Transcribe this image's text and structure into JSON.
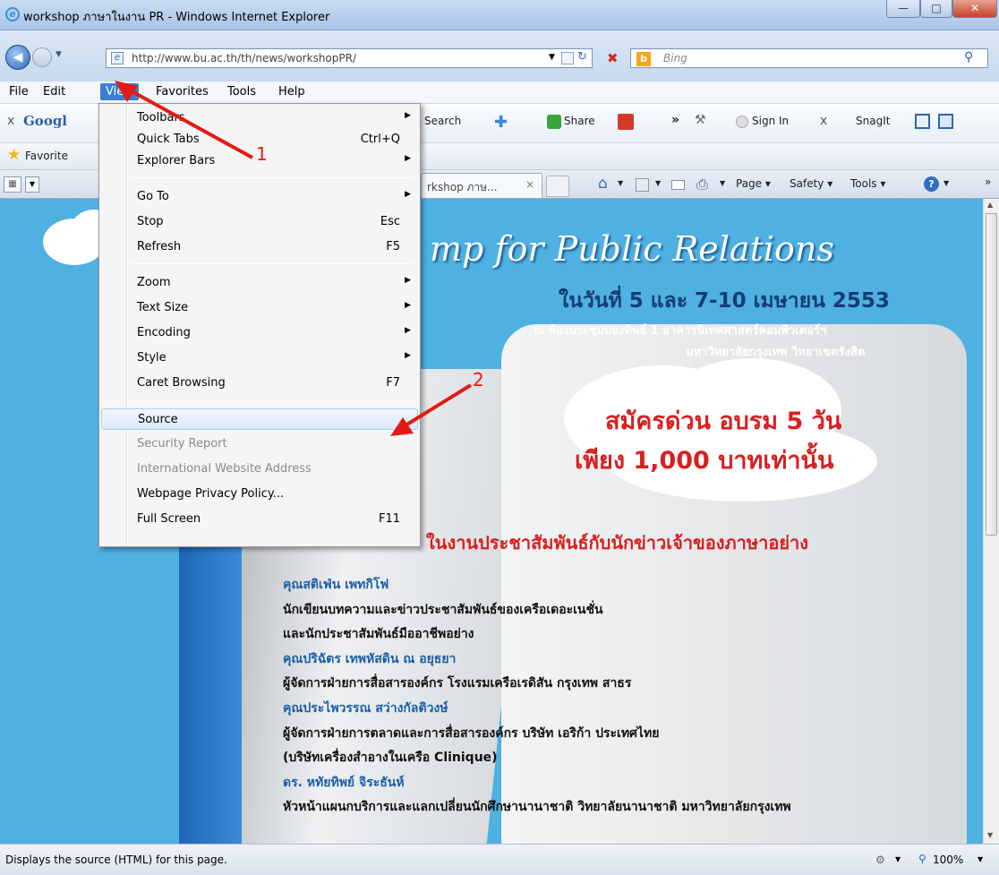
{
  "window": {
    "title": "workshop ภาษาในงาน PR - Windows Internet Explorer"
  },
  "address": {
    "url": "http://www.bu.ac.th/th/news/workshopPR/",
    "search_placeholder": "Bing"
  },
  "menubar": {
    "items": [
      "File",
      "Edit",
      "View",
      "Favorites",
      "Tools",
      "Help"
    ]
  },
  "toolbar": {
    "google": "Googl",
    "search": "Search",
    "share": "Share",
    "sign_in": "Sign In",
    "snagit": "SnagIt",
    "favorites": "Favorite",
    "tab_label": "rkshop ภาษ...",
    "page": "Page",
    "safety": "Safety",
    "tools": "Tools"
  },
  "view_menu": {
    "items": [
      {
        "label": "Toolbars",
        "shortcut": "",
        "submenu": true,
        "disabled": false
      },
      {
        "label": "Quick Tabs",
        "shortcut": "Ctrl+Q",
        "submenu": false,
        "disabled": false
      },
      {
        "label": "Explorer Bars",
        "shortcut": "",
        "submenu": true,
        "disabled": false
      },
      {
        "label": "Go To",
        "shortcut": "",
        "submenu": true,
        "disabled": false
      },
      {
        "label": "Stop",
        "shortcut": "Esc",
        "submenu": false,
        "disabled": false
      },
      {
        "label": "Refresh",
        "shortcut": "F5",
        "submenu": false,
        "disabled": false
      },
      {
        "label": "Zoom",
        "shortcut": "",
        "submenu": true,
        "disabled": false
      },
      {
        "label": "Text Size",
        "shortcut": "",
        "submenu": true,
        "disabled": false
      },
      {
        "label": "Encoding",
        "shortcut": "",
        "submenu": true,
        "disabled": false
      },
      {
        "label": "Style",
        "shortcut": "",
        "submenu": true,
        "disabled": false
      },
      {
        "label": "Caret Browsing",
        "shortcut": "F7",
        "submenu": false,
        "disabled": false
      },
      {
        "label": "Source",
        "shortcut": "",
        "submenu": false,
        "disabled": false,
        "highlighted": true
      },
      {
        "label": "Security Report",
        "shortcut": "",
        "submenu": false,
        "disabled": true
      },
      {
        "label": "International Website Address",
        "shortcut": "",
        "submenu": false,
        "disabled": true
      },
      {
        "label": "Webpage Privacy Policy...",
        "shortcut": "",
        "submenu": false,
        "disabled": false
      },
      {
        "label": "Full Screen",
        "shortcut": "F11",
        "submenu": false,
        "disabled": false
      }
    ]
  },
  "annotations": {
    "one": "1",
    "two": "2"
  },
  "page": {
    "headline": "mp for Public Relations",
    "date": "ในวันที่ 5 และ 7-10 เมษายน 2553",
    "venue1": "ณ ห้องประชุมปองทิพย์ 1 อาคารนิเทศศาสตร์คอมพิวเตอร์ฯ",
    "venue2": "มหาวิทยาลัยกรุงเทพ วิทยาเขตรังสิต",
    "promo1": "สมัครด่วน อบรม 5 วัน",
    "promo2": "เพียง 1,000 บาทเท่านั้น",
    "subtitle": "ในงานประชาสัมพันธ์กับนักข่าวเจ้าของภาษาอย่าง",
    "speakers": [
      {
        "text": "คุณสติเฟ่น เพทกิโฟ",
        "name": true
      },
      {
        "text": "นักเขียนบทความและข่าวประชาสัมพันธ์ของเครือเดอะเนชั่น",
        "name": false
      },
      {
        "text": "และนักประชาสัมพันธ์มืออาชีพอย่าง",
        "name": false
      },
      {
        "text": "คุณปริฉัตร เทพหัสดิน ณ อยุธยา",
        "name": true
      },
      {
        "text": "ผู้จัดการฝ่ายการสื่อสารองค์กร โรงแรมเครือเรดิสัน กรุงเทพ สาธร",
        "name": false
      },
      {
        "text": "คุณประไพวรรณ สว่างกัลติวงษ์",
        "name": true
      },
      {
        "text": "ผู้จัดการฝ่ายการตลาดและการสื่อสารองค์กร บริษัท เอริก้า ประเทศไทย",
        "name": false
      },
      {
        "text": "(บริษัทเครื่องสำอางในเครือ Clinique)",
        "name": false
      },
      {
        "text": "ดร. หทัยทิพย์ จิระธันห์",
        "name": true
      },
      {
        "text": "หัวหน้าแผนกบริการและแลกเปลี่ยนนักศึกษานานาชาติ วิทยาลัยนานาชาติ มหาวิทยาลัยกรุงเทพ",
        "name": false
      }
    ]
  },
  "status": {
    "text": "Displays the source (HTML) for this page.",
    "zoom": "100%"
  }
}
